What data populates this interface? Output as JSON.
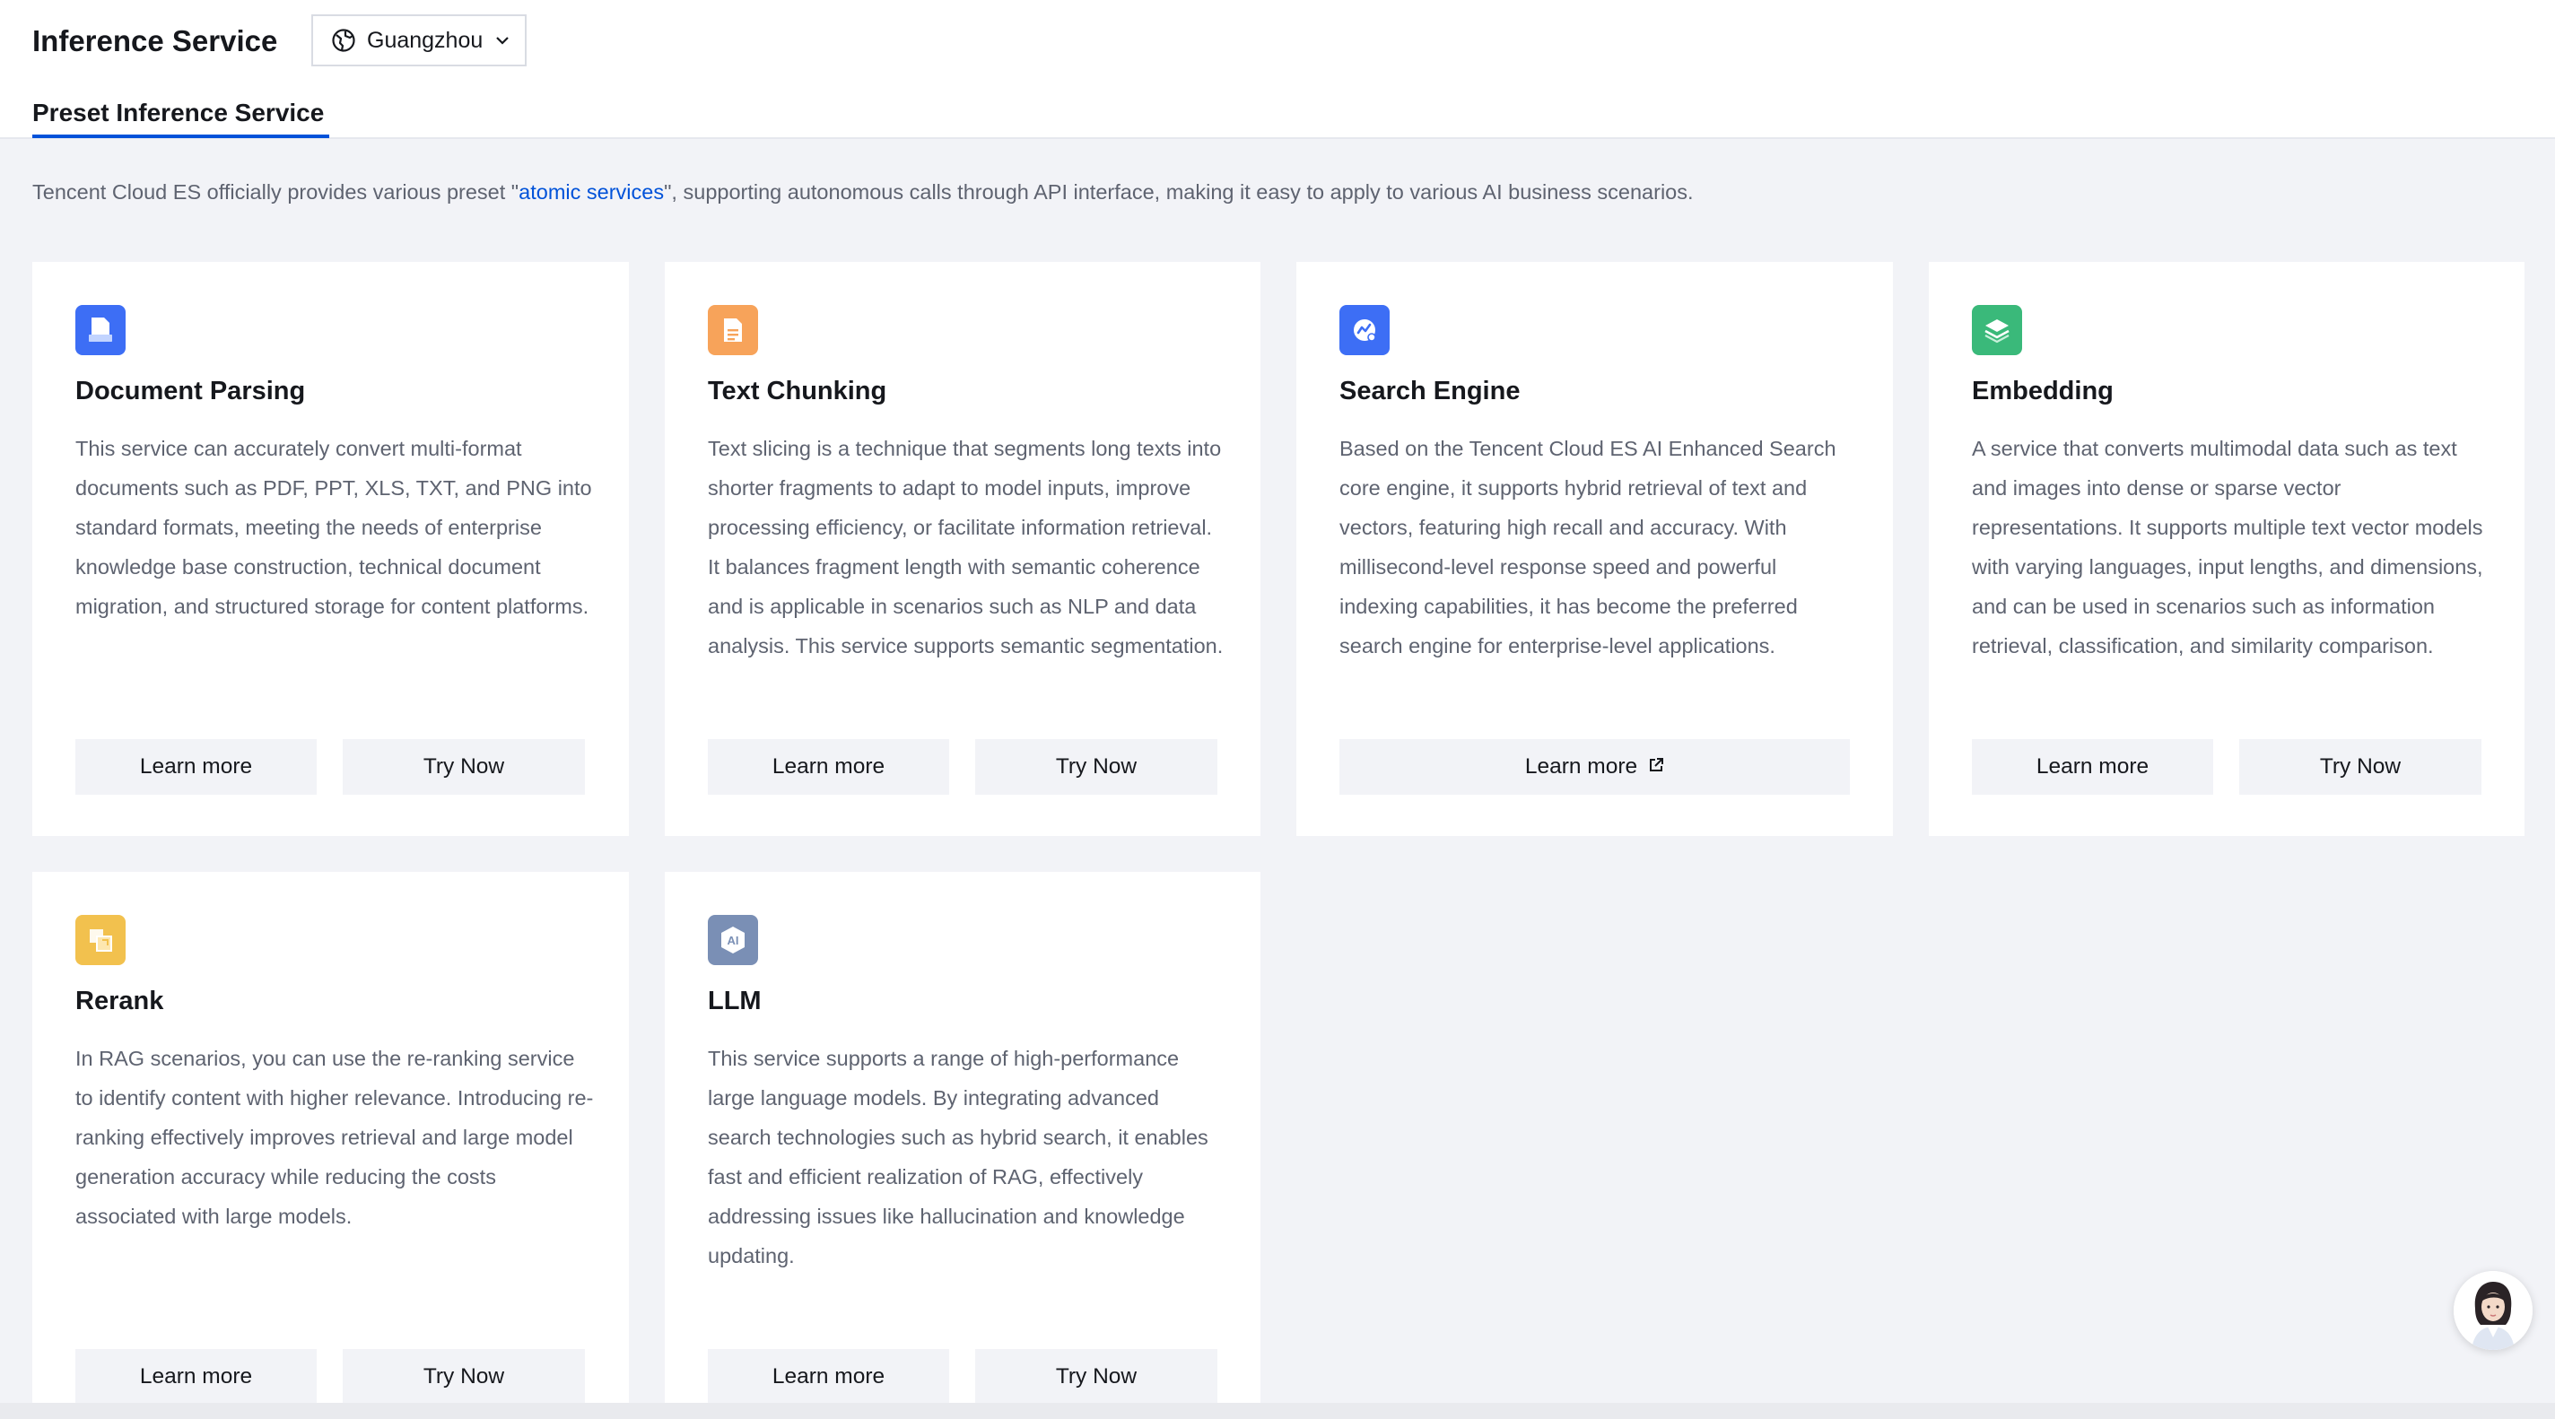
{
  "header": {
    "title": "Inference Service",
    "region": "Guangzhou",
    "tab": "Preset Inference Service"
  },
  "intro": {
    "prefix": "Tencent Cloud ES officially provides various preset \"",
    "link": "atomic services",
    "suffix": "\", supporting autonomous calls through API interface, making it easy to apply to various AI business scenarios."
  },
  "cards": [
    {
      "title": "Document Parsing",
      "icon": "document-icon",
      "icon_color": "#3d6ef5",
      "description": "This service can accurately convert multi-format documents such as PDF, PPT, XLS, TXT, and PNG into standard formats, meeting the needs of enterprise knowledge base construction, technical document migration, and structured storage for content platforms.",
      "learn_more": "Learn more",
      "try_now": "Try Now"
    },
    {
      "title": "Text Chunking",
      "icon": "text-chunk-icon",
      "icon_color": "#f7a35a",
      "description": "Text slicing is a technique that segments long texts into shorter fragments to adapt to model inputs, improve processing efficiency, or facilitate information retrieval. It balances fragment length with semantic coherence and is applicable in scenarios such as NLP and data analysis. This service supports semantic segmentation.",
      "learn_more": "Learn more",
      "try_now": "Try Now"
    },
    {
      "title": "Search Engine",
      "icon": "search-engine-icon",
      "icon_color": "#3d6ef5",
      "description": "Based on the Tencent Cloud ES AI Enhanced Search core engine, it supports hybrid retrieval of text and vectors, featuring high recall and accuracy. With millisecond-level response speed and powerful indexing capabilities, it has become the preferred search engine for enterprise-level applications.",
      "learn_more": "Learn more"
    },
    {
      "title": "Embedding",
      "icon": "layers-icon",
      "icon_color": "#3ab97a",
      "description": "A service that converts multimodal data such as text and images into dense or sparse vector representations. It supports multiple text vector models with varying languages, input lengths, and dimensions, and can be used in scenarios such as information retrieval, classification, and similarity comparison.",
      "learn_more": "Learn more",
      "try_now": "Try Now"
    },
    {
      "title": "Rerank",
      "icon": "rerank-icon",
      "icon_color": "#f2c14e",
      "description": "In RAG scenarios, you can use the re-ranking service to identify content with higher relevance. Introducing re-ranking effectively improves retrieval and large model generation accuracy while reducing the costs associated with large models.",
      "learn_more": "Learn more",
      "try_now": "Try Now"
    },
    {
      "title": "LLM",
      "icon": "ai-icon",
      "icon_color": "#7a8fb5",
      "description": "This service supports a range of high-performance large language models. By integrating advanced search technologies such as hybrid search, it enables fast and efficient realization of RAG, effectively addressing issues like hallucination and knowledge updating.",
      "learn_more": "Learn more",
      "try_now": "Try Now"
    }
  ]
}
